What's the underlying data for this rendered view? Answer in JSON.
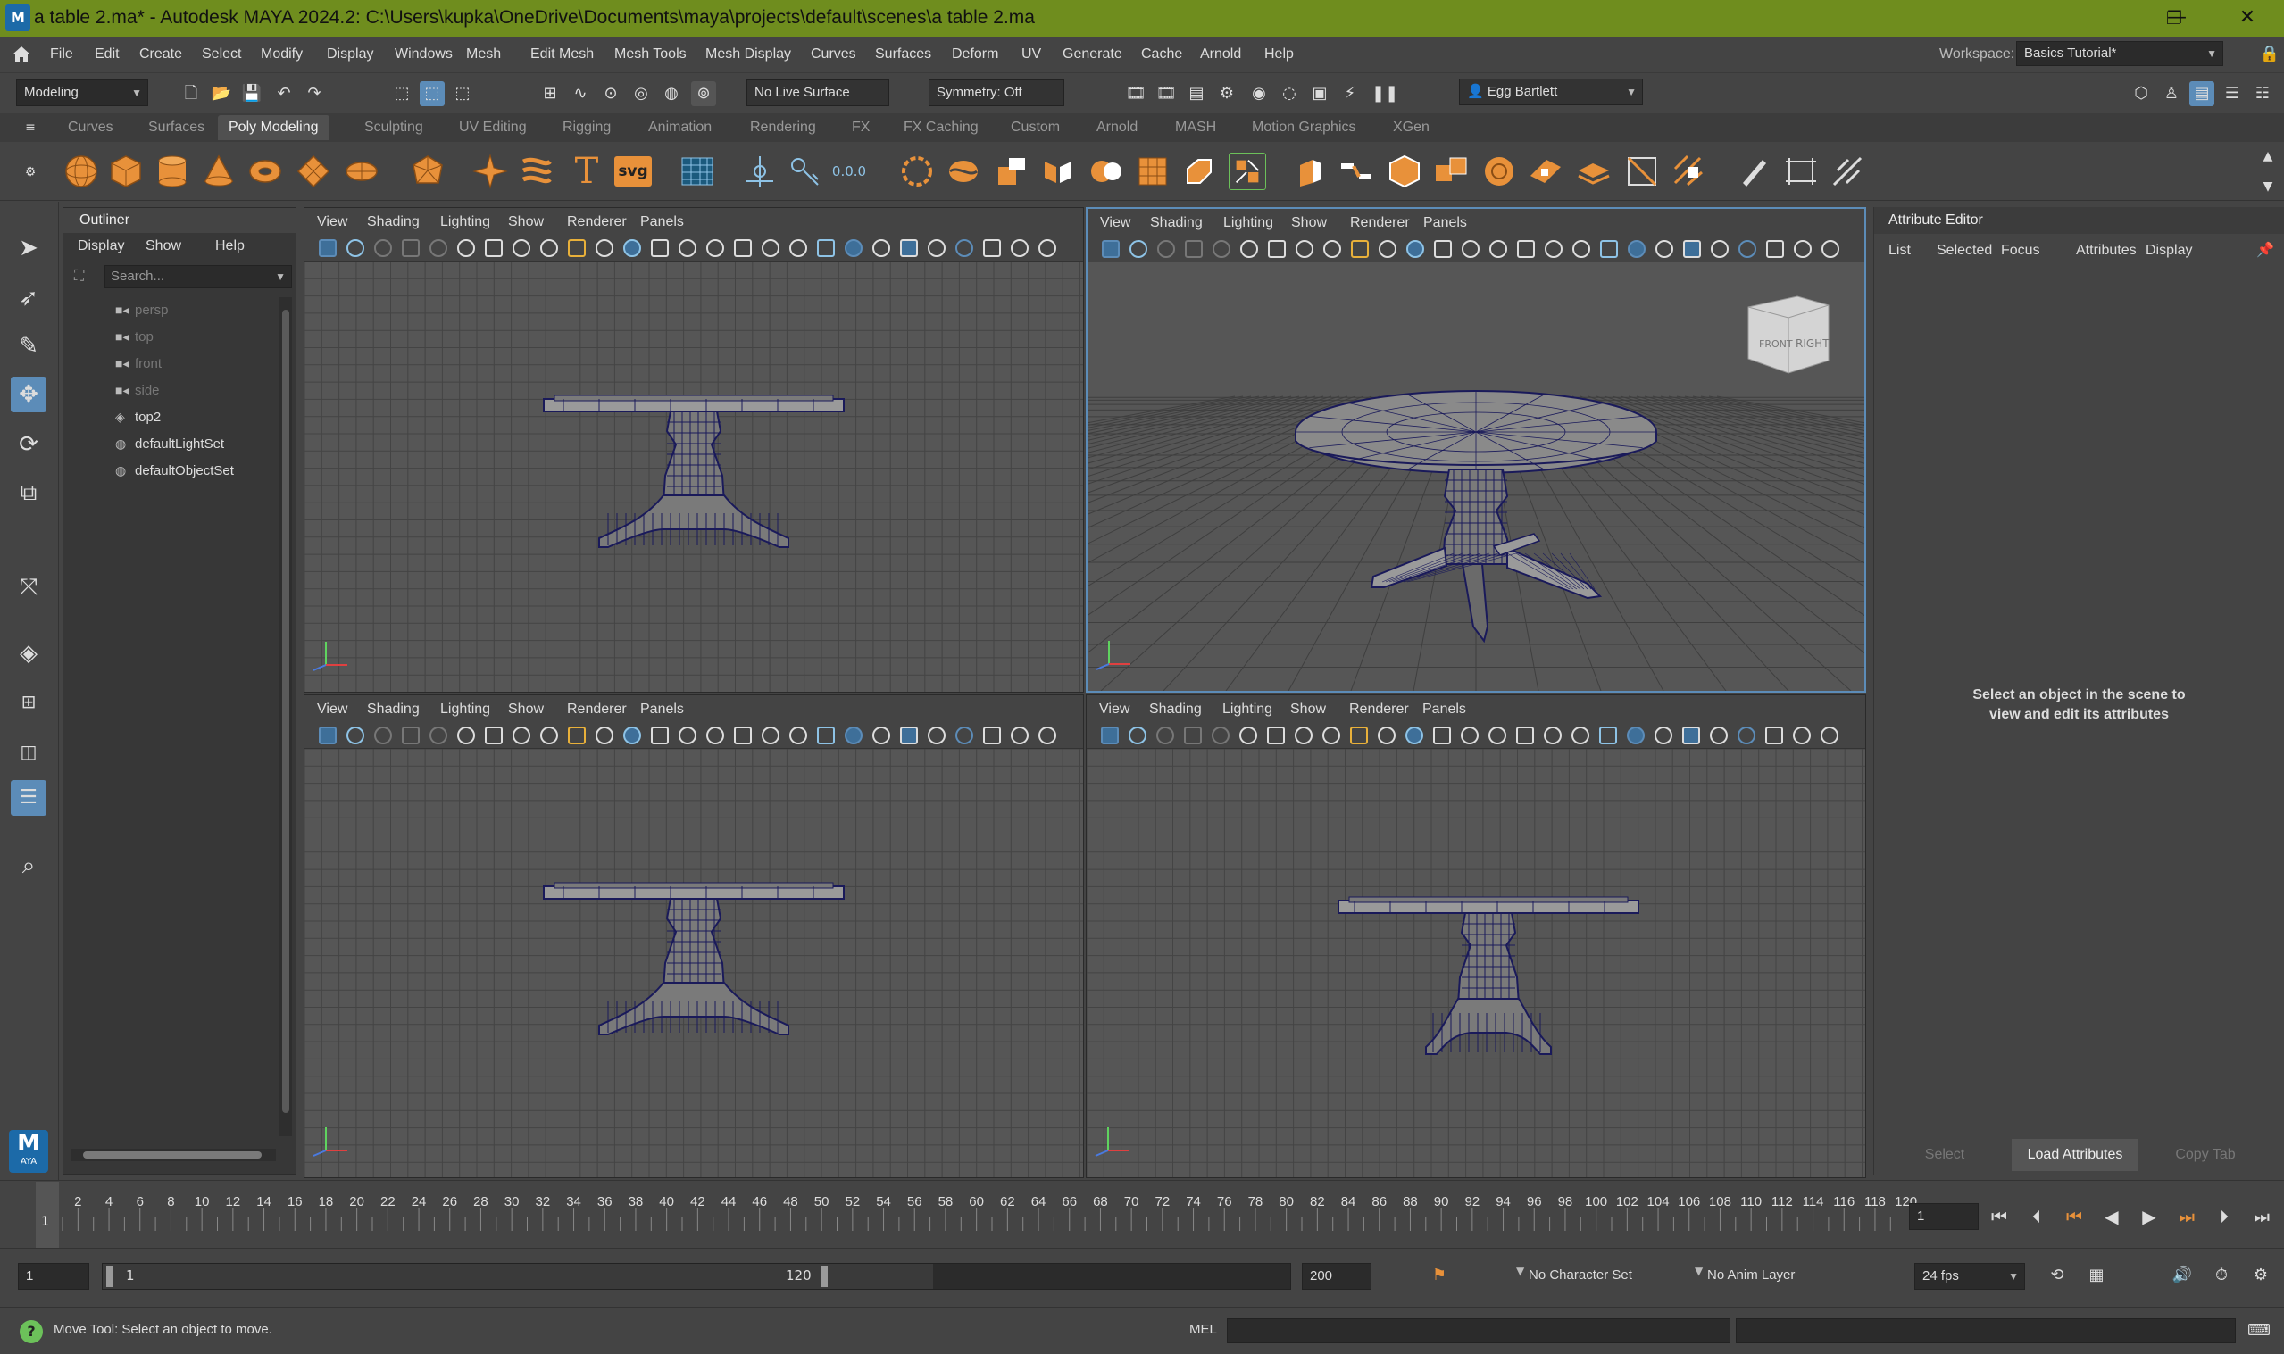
{
  "window": {
    "title": "a table 2.ma* - Autodesk MAYA 2024.2: C:\\Users\\kupka\\OneDrive\\Documents\\maya\\projects\\default\\scenes\\a table 2.ma",
    "minimize": "—",
    "restore": "❐",
    "close": "✕"
  },
  "menubar": {
    "items": [
      "File",
      "Edit",
      "Create",
      "Select",
      "Modify",
      "Display",
      "Windows",
      "Mesh",
      "Edit Mesh",
      "Mesh Tools",
      "Mesh Display",
      "Curves",
      "Surfaces",
      "Deform",
      "UV",
      "Generate",
      "Cache",
      "Arnold",
      "Help"
    ],
    "workspace_label": "Workspace:",
    "workspace_value": "Basics Tutorial*"
  },
  "statusline": {
    "mode": "Modeling",
    "live_surface": "No Live Surface",
    "symmetry": "Symmetry: Off",
    "user": "Egg Bartlett"
  },
  "shelf": {
    "tabs": [
      "Curves",
      "Surfaces",
      "Poly Modeling",
      "Sculpting",
      "UV Editing",
      "Rigging",
      "Animation",
      "Rendering",
      "FX",
      "FX Caching",
      "Custom",
      "Arnold",
      "MASH",
      "Motion Graphics",
      "XGen"
    ],
    "active_tab": "Poly Modeling",
    "svg_label": "svg",
    "text_label": "T",
    "coord_label": "0.0.0"
  },
  "outliner": {
    "title": "Outliner",
    "menus": [
      "Display",
      "Show",
      "Help"
    ],
    "search_placeholder": "Search...",
    "items": [
      {
        "label": "persp",
        "state": "dim",
        "icon": "camera-icon"
      },
      {
        "label": "top",
        "state": "dim",
        "icon": "camera-icon"
      },
      {
        "label": "front",
        "state": "dim",
        "icon": "camera-icon"
      },
      {
        "label": "side",
        "state": "dim",
        "icon": "camera-icon"
      },
      {
        "label": "top2",
        "state": "lit",
        "icon": "mesh-icon"
      },
      {
        "label": "defaultLightSet",
        "state": "lit",
        "icon": "set-icon"
      },
      {
        "label": "defaultObjectSet",
        "state": "lit",
        "icon": "set-icon"
      }
    ]
  },
  "viewport": {
    "menus": [
      "View",
      "Shading",
      "Lighting",
      "Show",
      "Renderer",
      "Panels"
    ],
    "viewcube_front": "FRONT",
    "viewcube_right": "RIGHT"
  },
  "attribute_editor": {
    "title": "Attribute Editor",
    "menus": [
      "List",
      "Selected",
      "Focus",
      "Attributes",
      "Display"
    ],
    "message_line1": "Select an object in the scene to",
    "message_line2": "view and edit its attributes",
    "buttons": {
      "select": "Select",
      "load": "Load Attributes",
      "copy": "Copy Tab"
    }
  },
  "timeline": {
    "ticks": [
      "2",
      "4",
      "6",
      "8",
      "10",
      "12",
      "14",
      "16",
      "18",
      "20",
      "22",
      "24",
      "26",
      "28",
      "30",
      "32",
      "34",
      "36",
      "38",
      "40",
      "42",
      "44",
      "46",
      "48",
      "50",
      "52",
      "54",
      "56",
      "58",
      "60",
      "62",
      "64",
      "66",
      "68",
      "70",
      "72",
      "74",
      "76",
      "78",
      "80",
      "82",
      "84",
      "86",
      "88",
      "90",
      "92",
      "94",
      "96",
      "98",
      "100",
      "102",
      "104",
      "106",
      "108",
      "110",
      "112",
      "114",
      "116",
      "118",
      "120"
    ],
    "first_frame_marker": "1",
    "current_frame": "1"
  },
  "range": {
    "start": "1",
    "playback_start": "1",
    "playback_end": "120",
    "end": "200",
    "character_set": "No Character Set",
    "anim_layer": "No Anim Layer",
    "fps": "24 fps"
  },
  "helpline": {
    "message": "Move Tool: Select an object to move.",
    "mel_label": "MEL",
    "badge": "M",
    "badge_sub": "AYA"
  },
  "colors": {
    "titlebar": "#6f8d1e",
    "accent_blue": "#5c8cb8",
    "shelf_orange": "#e8913a",
    "mesh_wire": "#1a1a5a"
  }
}
